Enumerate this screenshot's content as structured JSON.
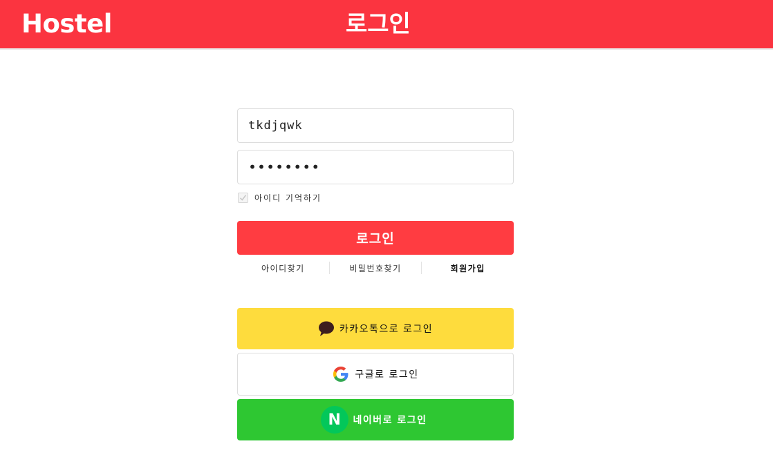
{
  "header": {
    "brand": "Hostel",
    "title": "로그인",
    "background_color": "#fb3440"
  },
  "form": {
    "id_value": "tkdjqwk",
    "password_mask": "••••••••",
    "remember_label": "아이디 기억하기",
    "remember_checked": true,
    "login_button_label": "로그인",
    "login_button_color": "#ff3c41"
  },
  "links": [
    {
      "label": "아이디찾기"
    },
    {
      "label": "비밀번호찾기"
    },
    {
      "label": "회원가입"
    }
  ],
  "social": {
    "kakao": {
      "label": "카카오톡으로 로그인",
      "icon": "kakao-speech-bubble-icon",
      "color": "#fedc3d"
    },
    "google": {
      "label": "구글로 로그인",
      "icon": "google-g-icon",
      "color": "#ffffff"
    },
    "naver": {
      "label": "네이버로 로그인",
      "icon": "naver-n-icon",
      "icon_letter": "N",
      "color": "#2ec732"
    }
  }
}
